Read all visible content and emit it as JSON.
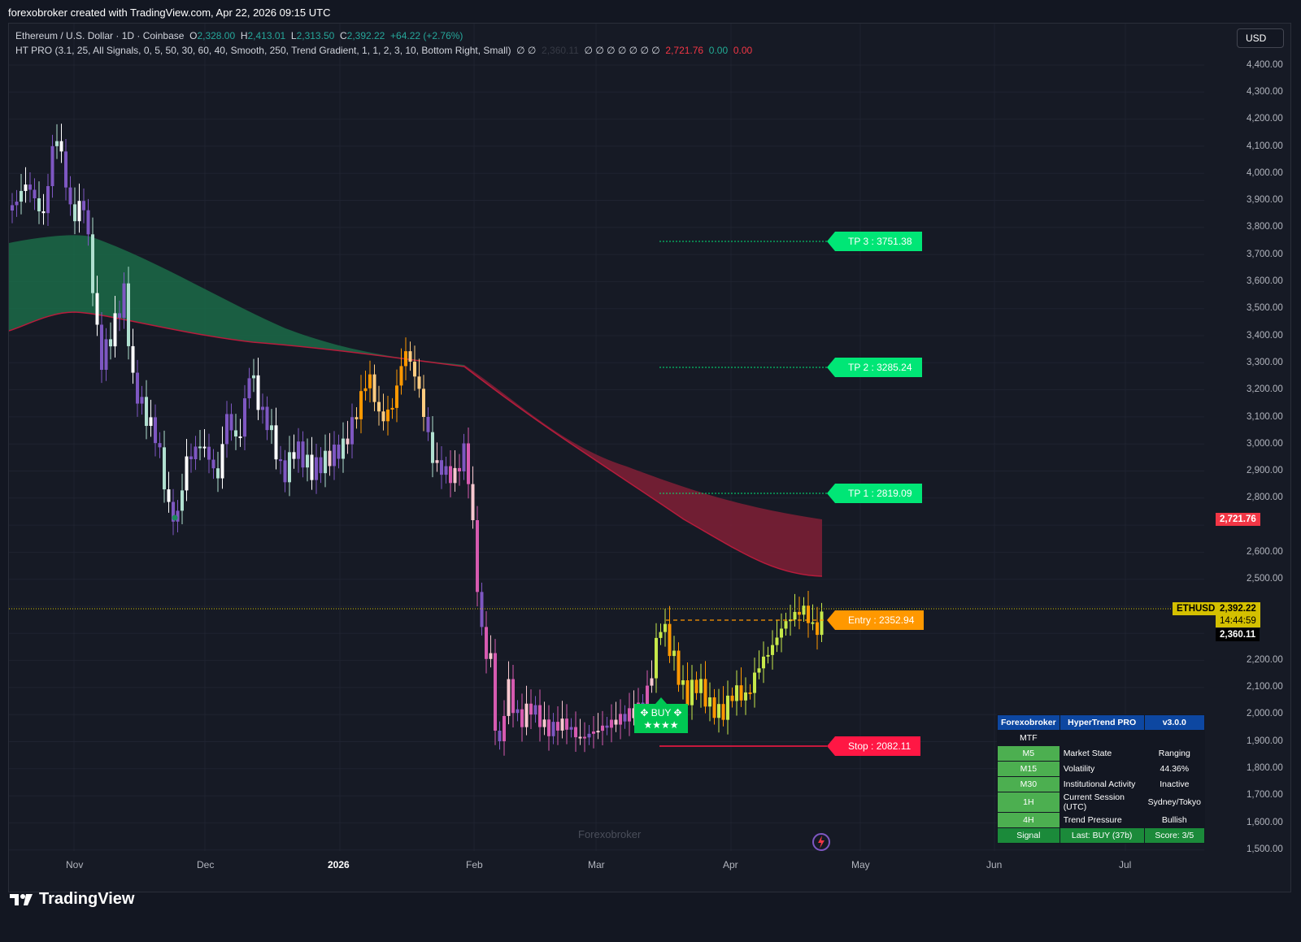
{
  "header": {
    "caption": "forexobroker created with TradingView.com, Apr 22, 2026 09:15 UTC"
  },
  "legend": {
    "symbol": "Ethereum / U.S. Dollar · 1D · Coinbase",
    "o_label": "O",
    "o": "2,328.00",
    "h_label": "H",
    "h": "2,413.01",
    "l_label": "L",
    "l": "2,313.50",
    "c_label": "C",
    "c": "2,392.22",
    "change": "+64.22 (+2.76%)",
    "indicator": "HT PRO (3.1, 25, All Signals, 0, 5, 50, 30, 60, 40, Smooth, 250, Trend Gradient, 1, 1, 2, 3, 10, Bottom Right, Small)",
    "ind_vals_a": "∅ ∅",
    "ind_val_dark": "2,360.11",
    "ind_vals_b": "∅ ∅ ∅ ∅ ∅ ∅ ∅",
    "ind_val_red": "2,721.76",
    "ind_val_g": "0.00",
    "ind_val_r2": "0.00"
  },
  "currency_button": "USD",
  "y_axis": [
    "4,400.00",
    "4,300.00",
    "4,200.00",
    "4,100.00",
    "4,000.00",
    "3,900.00",
    "3,800.00",
    "3,700.00",
    "3,600.00",
    "3,500.00",
    "3,400.00",
    "3,300.00",
    "3,200.00",
    "3,100.00",
    "3,000.00",
    "2,900.00",
    "2,800.00",
    "2,600.00",
    "2,500.00",
    "2,200.00",
    "2,100.00",
    "2,000.00",
    "1,900.00",
    "1,800.00",
    "1,700.00",
    "1,600.00",
    "1,500.00"
  ],
  "x_axis": [
    "Nov",
    "Dec",
    "2026",
    "Feb",
    "Mar",
    "Apr",
    "May",
    "Jun",
    "Jul"
  ],
  "price_tags": {
    "band_top": "2,721.76",
    "symbol_tag": "ETHUSD",
    "last": "2,392.22",
    "countdown": "14:44:59",
    "line": "2,360.11"
  },
  "levels": {
    "tp3": "TP 3 : 3751.38",
    "tp2": "TP 2 : 3285.24",
    "tp1": "TP 1 : 2819.09",
    "entry": "Entry : 2352.94",
    "stop": "Stop : 2082.11"
  },
  "signal": {
    "label": "✥ BUY ✥",
    "stars": "★★★★"
  },
  "watermark": "Forexobroker",
  "dashboard": {
    "header": [
      "Forexobroker",
      "HyperTrend PRO",
      "v3.0.0"
    ],
    "mtf": "MTF",
    "rows": [
      {
        "tf": "M5",
        "k": "Market State",
        "v": "Ranging"
      },
      {
        "tf": "M15",
        "k": "Volatility",
        "v": "44.36%"
      },
      {
        "tf": "M30",
        "k": "Institutional Activity",
        "v": "Inactive"
      },
      {
        "tf": "1H",
        "k": "Current Session (UTC)",
        "v": "Sydney/Tokyo"
      },
      {
        "tf": "4H",
        "k": "Trend Pressure",
        "v": "Bullish"
      }
    ],
    "footer": [
      "Signal",
      "Last: BUY (37b)",
      "Score: 3/5"
    ]
  },
  "footer": {
    "brand": "TradingView"
  },
  "colors": {
    "bg": "#161a25",
    "up": "#26a69a",
    "green_band": "#1e7a52",
    "red_band": "#7a1f35",
    "tp": "#00e676",
    "entry": "#ff9800",
    "stop": "#ff1744"
  }
}
